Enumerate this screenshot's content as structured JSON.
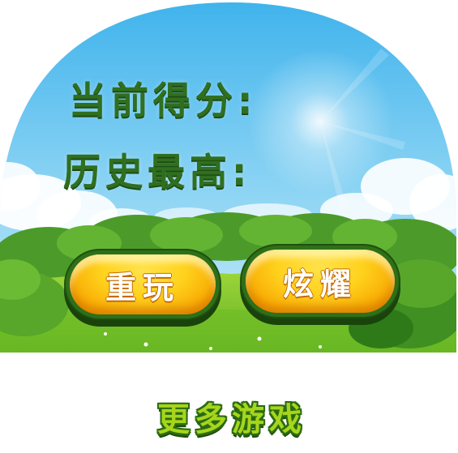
{
  "score_panel": {
    "current_score_label": "当前得分:",
    "best_score_label": "历史最高:"
  },
  "buttons": {
    "replay_label": "重玩",
    "show_off_label": "炫耀",
    "more_games_label": "更多游戏"
  },
  "colors": {
    "sky_top": "#3fb3ec",
    "sky_bottom": "#bfe9f9",
    "grass": "#7cc225",
    "label_green": "#2f6f1f",
    "button_yellow": "#ffd21d",
    "more_games_green": "#a6d51c"
  }
}
